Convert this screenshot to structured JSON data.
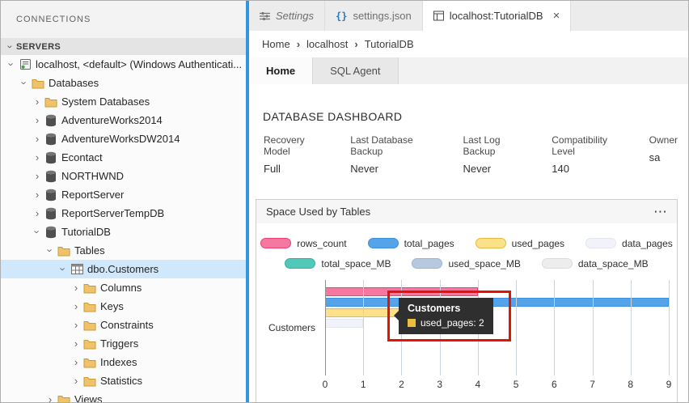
{
  "colors": {
    "accent_blue": "#3296dc",
    "annotation_red": "#e51400",
    "selected_row_blue": "#cfe8fb"
  },
  "sidebar": {
    "header": "CONNECTIONS",
    "section": "SERVERS",
    "tree": [
      {
        "label": "localhost, <default> (Windows Authenticati...",
        "level": 0,
        "icon": "server",
        "expanded": true,
        "selected": false
      },
      {
        "label": "Databases",
        "level": 1,
        "icon": "folder",
        "expanded": true,
        "selected": false
      },
      {
        "label": "System Databases",
        "level": 2,
        "icon": "folder",
        "expanded": false,
        "selected": false
      },
      {
        "label": "AdventureWorks2014",
        "level": 2,
        "icon": "database",
        "expanded": false,
        "selected": false
      },
      {
        "label": "AdventureWorksDW2014",
        "level": 2,
        "icon": "database",
        "expanded": false,
        "selected": false
      },
      {
        "label": "Econtact",
        "level": 2,
        "icon": "database",
        "expanded": false,
        "selected": false
      },
      {
        "label": "NORTHWND",
        "level": 2,
        "icon": "database",
        "expanded": false,
        "selected": false
      },
      {
        "label": "ReportServer",
        "level": 2,
        "icon": "database",
        "expanded": false,
        "selected": false
      },
      {
        "label": "ReportServerTempDB",
        "level": 2,
        "icon": "database",
        "expanded": false,
        "selected": false
      },
      {
        "label": "TutorialDB",
        "level": 2,
        "icon": "database",
        "expanded": true,
        "selected": false
      },
      {
        "label": "Tables",
        "level": 3,
        "icon": "folder",
        "expanded": true,
        "selected": false
      },
      {
        "label": "dbo.Customers",
        "level": 4,
        "icon": "table",
        "expanded": true,
        "selected": true
      },
      {
        "label": "Columns",
        "level": 5,
        "icon": "folder",
        "expanded": false,
        "selected": false
      },
      {
        "label": "Keys",
        "level": 5,
        "icon": "folder",
        "expanded": false,
        "selected": false
      },
      {
        "label": "Constraints",
        "level": 5,
        "icon": "folder",
        "expanded": false,
        "selected": false
      },
      {
        "label": "Triggers",
        "level": 5,
        "icon": "folder",
        "expanded": false,
        "selected": false
      },
      {
        "label": "Indexes",
        "level": 5,
        "icon": "folder",
        "expanded": false,
        "selected": false
      },
      {
        "label": "Statistics",
        "level": 5,
        "icon": "folder",
        "expanded": false,
        "selected": false
      },
      {
        "label": "Views",
        "level": 3,
        "icon": "folder",
        "expanded": false,
        "selected": false
      }
    ]
  },
  "editor_tabs": [
    {
      "label": "Settings",
      "icon": "settings",
      "active": false,
      "italic": true,
      "closable": false
    },
    {
      "label": "settings.json",
      "icon": "json",
      "active": false,
      "italic": false,
      "closable": false
    },
    {
      "label": "localhost:TutorialDB",
      "icon": "dashboard",
      "active": true,
      "italic": false,
      "closable": true
    }
  ],
  "breadcrumb": [
    "Home",
    "localhost",
    "TutorialDB"
  ],
  "dashboard_tabs": [
    {
      "label": "Home",
      "active": true
    },
    {
      "label": "SQL Agent",
      "active": false
    }
  ],
  "dashboard": {
    "title": "DATABASE DASHBOARD",
    "properties": [
      {
        "label": "Recovery Model",
        "value": "Full"
      },
      {
        "label": "Last Database Backup",
        "value": "Never"
      },
      {
        "label": "Last Log Backup",
        "value": "Never"
      },
      {
        "label": "Compatibility Level",
        "value": "140"
      },
      {
        "label": "Owner",
        "value": "sa"
      }
    ]
  },
  "panel": {
    "title": "Space Used by Tables",
    "menu_glyph": "⋯"
  },
  "chart_data": {
    "type": "bar",
    "orientation": "horizontal",
    "title": "Space Used by Tables",
    "categories": [
      "Customers"
    ],
    "series": [
      {
        "name": "rows_count",
        "color": "#f478a0",
        "border": "#ee3f72",
        "values": [
          4
        ]
      },
      {
        "name": "total_pages",
        "color": "#55a3e8",
        "border": "#3c91dd",
        "values": [
          9
        ]
      },
      {
        "name": "used_pages",
        "color": "#fce08a",
        "border": "#e8b93c",
        "values": [
          2
        ]
      },
      {
        "name": "data_pages",
        "color": "#f2f3fa",
        "border": "#e3e5ef",
        "values": [
          1
        ]
      },
      {
        "name": "total_space_MB",
        "color": "#52c8b8",
        "border": "#2eb3a2",
        "values": [
          0
        ]
      },
      {
        "name": "used_space_MB",
        "color": "#b7c9de",
        "border": "#9eb6d3",
        "values": [
          0
        ]
      },
      {
        "name": "data_space_MB",
        "color": "#ededed",
        "border": "#dcdcdc",
        "values": [
          0
        ]
      }
    ],
    "xlim": [
      0,
      9
    ],
    "x_ticks": [
      0,
      1,
      2,
      3,
      4,
      5,
      6,
      7,
      8,
      9
    ],
    "grid": true,
    "legend_position": "top"
  },
  "tooltip": {
    "title": "Customers",
    "line": "used_pages: 2",
    "swatch_color": "#edbd3d"
  }
}
